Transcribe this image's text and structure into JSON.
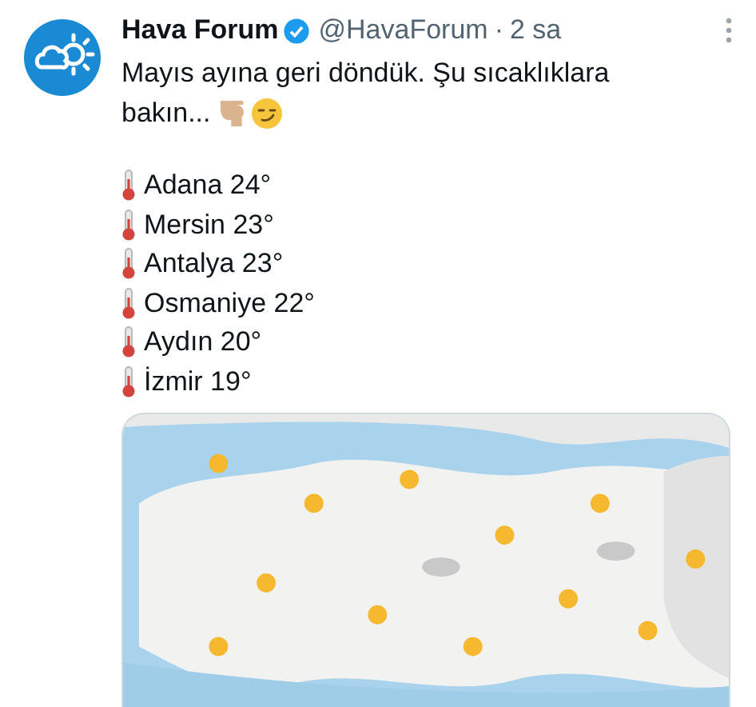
{
  "author": {
    "name": "Hava Forum",
    "verified": true,
    "handle": "@HavaForum",
    "separator": "·",
    "time": "2 sa"
  },
  "text_lines": [
    "Mayıs ayına geri döndük. Şu sıcaklıklara",
    "bakın..."
  ],
  "temperatures": [
    {
      "city": "Adana 24°"
    },
    {
      "city": "Mersin 23°"
    },
    {
      "city": "Antalya 23°"
    },
    {
      "city": "Osmaniye 22°"
    },
    {
      "city": "Aydın 20°"
    },
    {
      "city": "İzmir 19°"
    }
  ]
}
